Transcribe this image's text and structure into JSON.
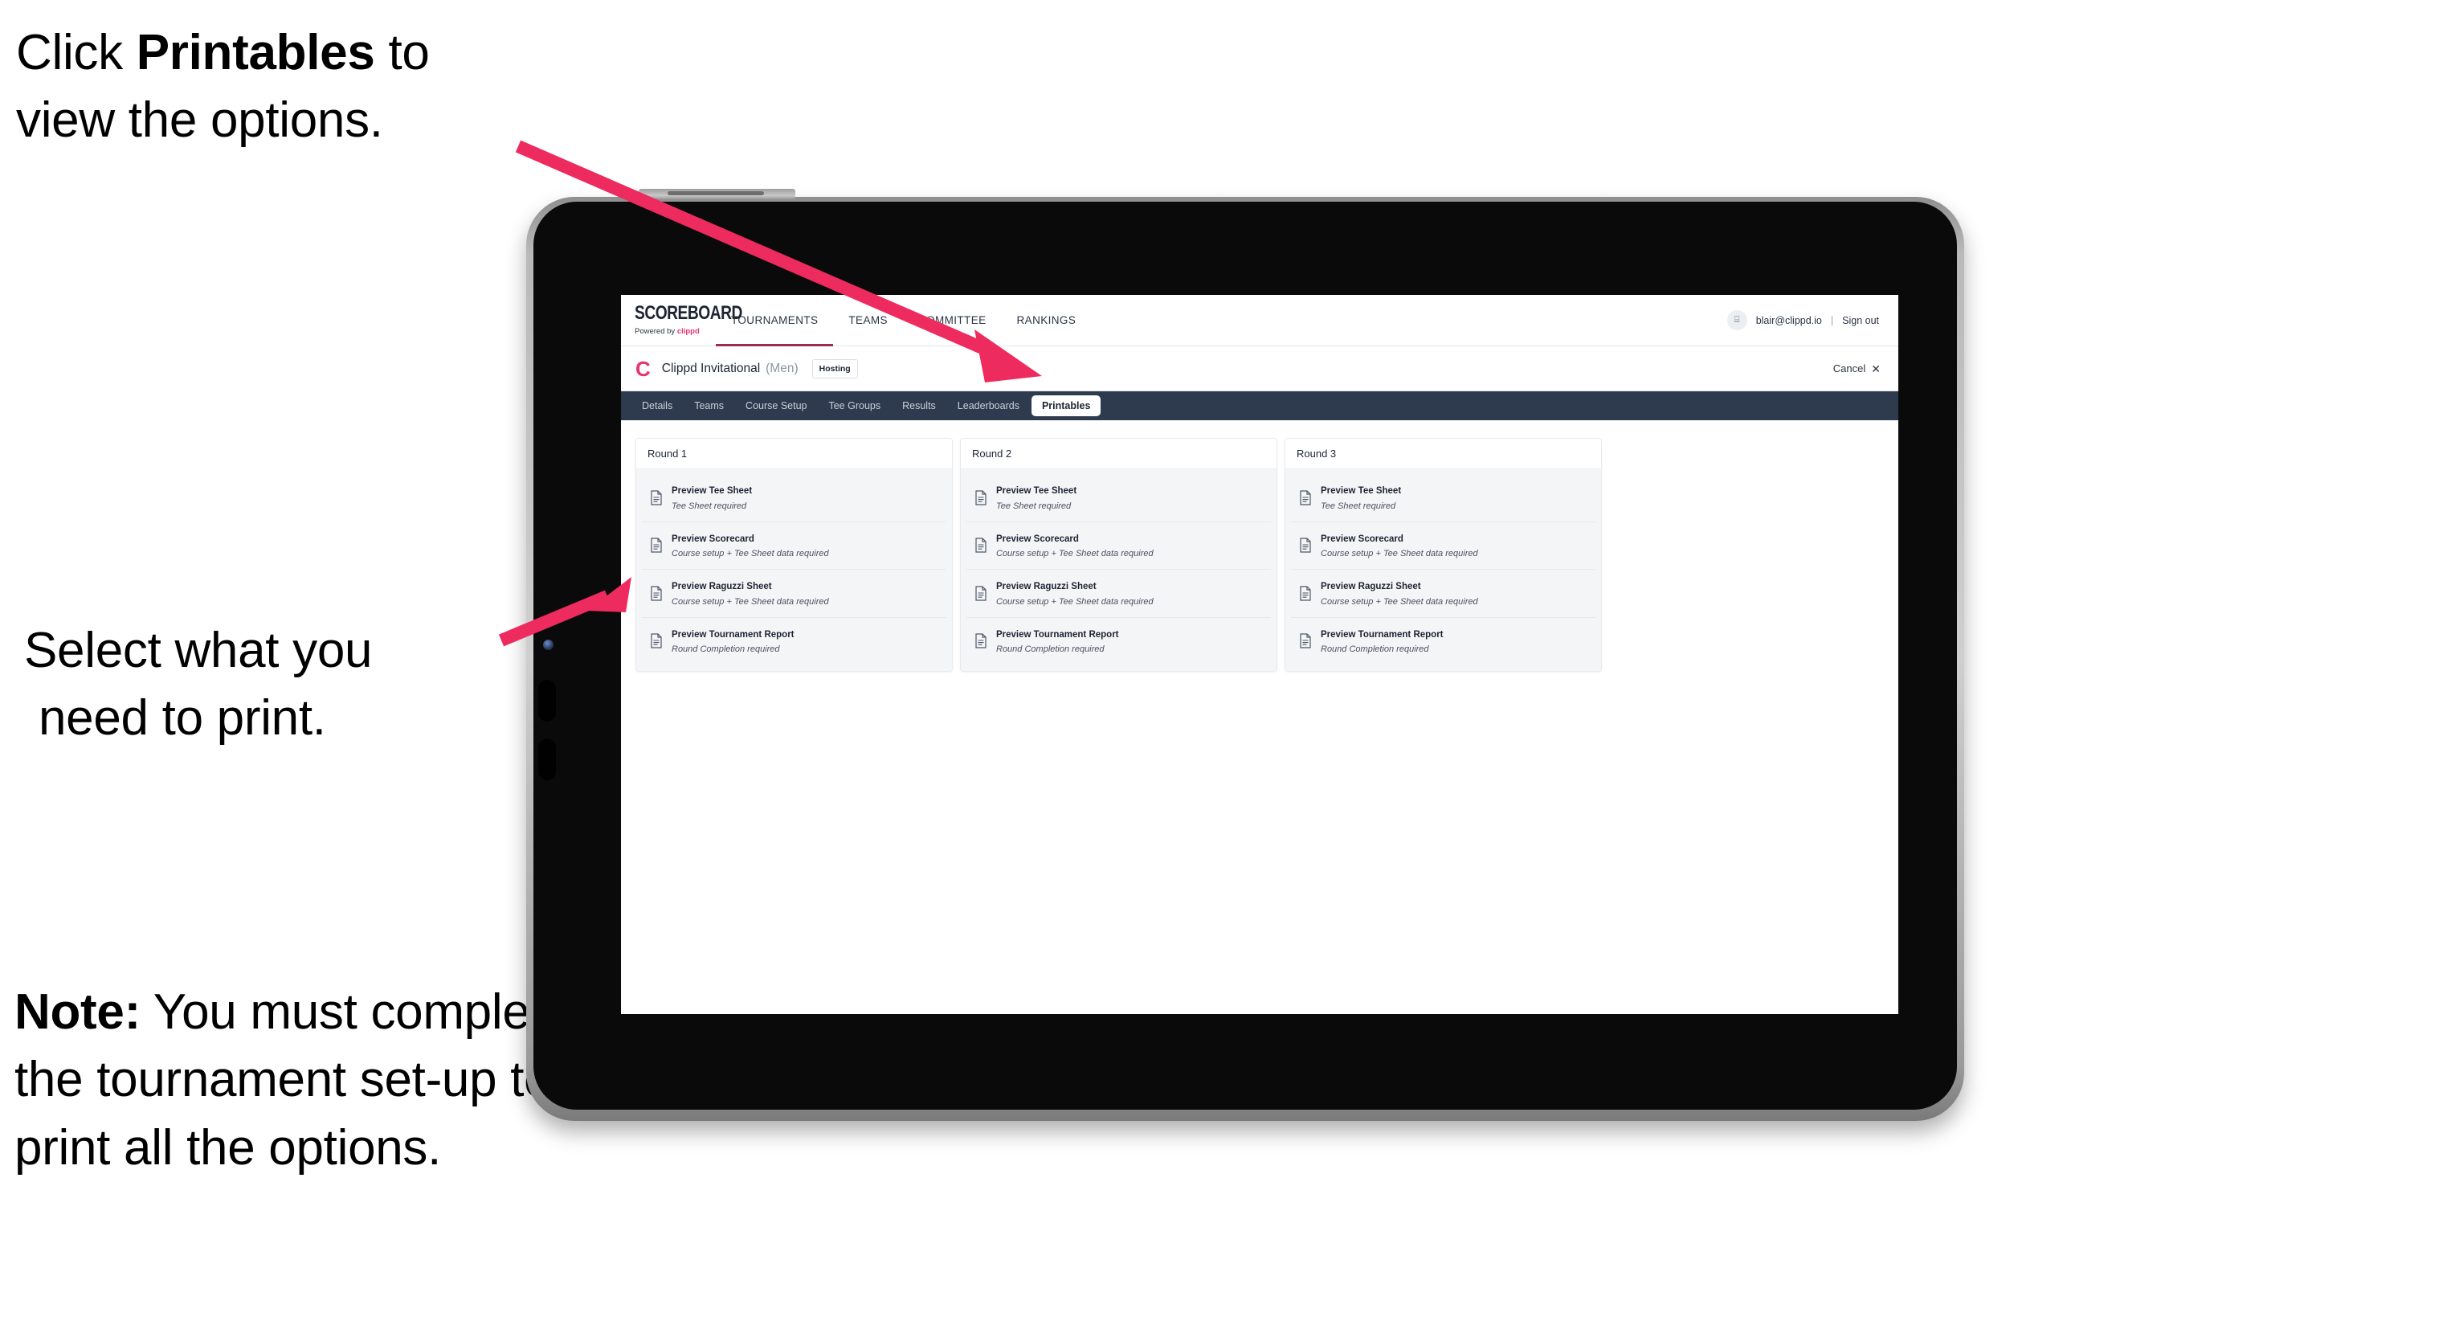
{
  "annotations": {
    "click_printables": {
      "line1_prefix": "Click ",
      "line1_bold": "Printables",
      "line1_suffix": " to",
      "line2": "view the options."
    },
    "select_print": {
      "line1": "Select what you",
      "line2": "need to print."
    },
    "note": {
      "label": "Note:",
      "body": " You must complete the tournament set-up to print all the options."
    }
  },
  "colors": {
    "arrow_pink": "#ee2b5e",
    "brand_pink": "#e8336b",
    "tabstrip_navy": "#2e3b4e",
    "active_tab_underline": "#9e2b4e",
    "card_body_gray": "#f4f5f7"
  },
  "browser": {
    "topnav": {
      "logo_word": "SCOREBOARD",
      "logo_sub_prefix": "Powered by ",
      "logo_sub_brand": "clippd",
      "items": [
        {
          "label": "TOURNAMENTS",
          "active": true
        },
        {
          "label": "TEAMS",
          "active": false
        },
        {
          "label": "COMMITTEE",
          "active": false
        },
        {
          "label": "RANKINGS",
          "active": false
        }
      ],
      "avatar_icon": "user-avatar-icon",
      "avatar_glyph": "⌸",
      "user_email": "blair@clippd.io",
      "separator": "|",
      "sign_out": "Sign out"
    },
    "subheader": {
      "clippd_mark": "C",
      "tournament_name": "Clippd Invitational",
      "gender": "(Men)",
      "hosting_badge": "Hosting",
      "cancel_label": "Cancel",
      "cancel_icon_glyph": "✕"
    },
    "tabs": [
      {
        "label": "Details",
        "active": false
      },
      {
        "label": "Teams",
        "active": false
      },
      {
        "label": "Course Setup",
        "active": false
      },
      {
        "label": "Tee Groups",
        "active": false
      },
      {
        "label": "Results",
        "active": false
      },
      {
        "label": "Leaderboards",
        "active": false
      },
      {
        "label": "Printables",
        "active": true
      }
    ],
    "rounds": [
      {
        "title": "Round 1",
        "items": [
          {
            "title": "Preview Tee Sheet",
            "sub": "Tee Sheet required"
          },
          {
            "title": "Preview Scorecard",
            "sub": "Course setup + Tee Sheet data required"
          },
          {
            "title": "Preview Raguzzi Sheet",
            "sub": "Course setup + Tee Sheet data required"
          },
          {
            "title": "Preview Tournament Report",
            "sub": "Round Completion required"
          }
        ]
      },
      {
        "title": "Round 2",
        "items": [
          {
            "title": "Preview Tee Sheet",
            "sub": "Tee Sheet required"
          },
          {
            "title": "Preview Scorecard",
            "sub": "Course setup + Tee Sheet data required"
          },
          {
            "title": "Preview Raguzzi Sheet",
            "sub": "Course setup + Tee Sheet data required"
          },
          {
            "title": "Preview Tournament Report",
            "sub": "Round Completion required"
          }
        ]
      },
      {
        "title": "Round 3",
        "items": [
          {
            "title": "Preview Tee Sheet",
            "sub": "Tee Sheet required"
          },
          {
            "title": "Preview Scorecard",
            "sub": "Course setup + Tee Sheet data required"
          },
          {
            "title": "Preview Raguzzi Sheet",
            "sub": "Course setup + Tee Sheet data required"
          },
          {
            "title": "Preview Tournament Report",
            "sub": "Round Completion required"
          }
        ]
      }
    ]
  }
}
